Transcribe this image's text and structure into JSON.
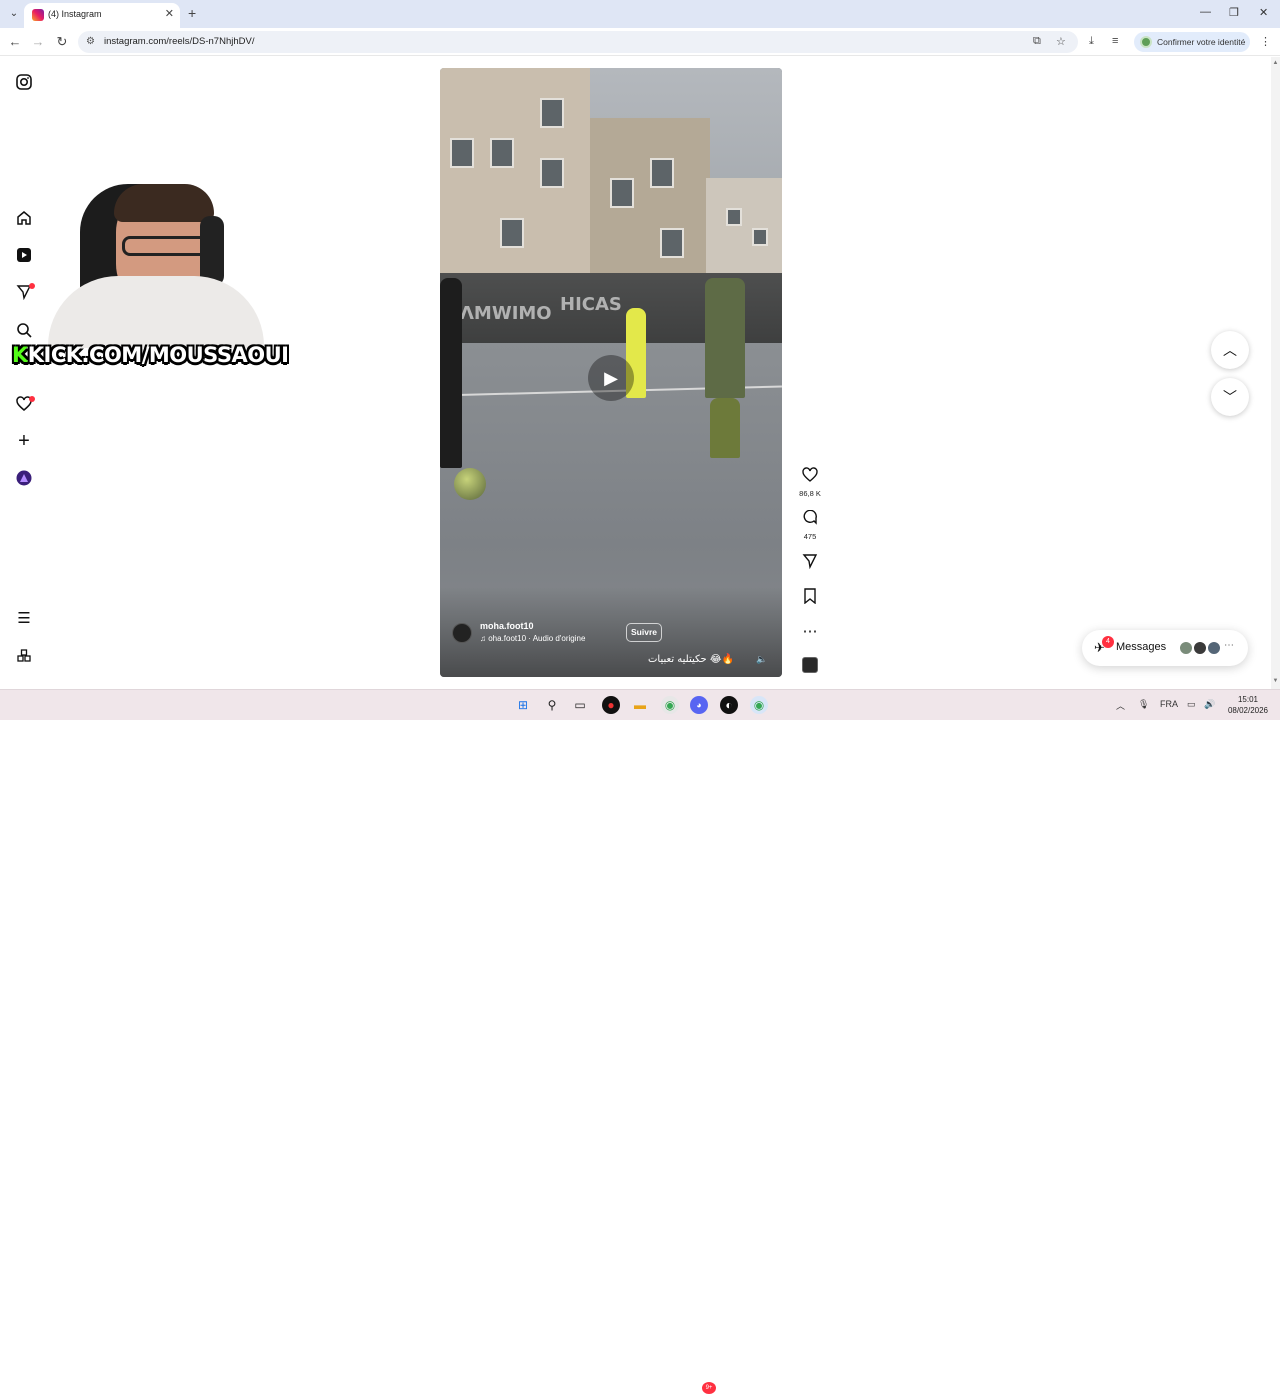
{
  "browser": {
    "tab_title": "(4) Instagram",
    "url": "instagram.com/reels/DS-n7NhjhDV/",
    "identity_label": "Confirmer votre identité"
  },
  "overlay": {
    "kick_letter": "K",
    "kick_text": "KICK.COM/MOUSSAOUI"
  },
  "sidebar": {
    "messages_badge": "4"
  },
  "reel": {
    "author": "moha.foot10",
    "audio": "oha.foot10 · Audio d'origine",
    "follow_label": "Suivre",
    "caption": "حكيتليه تعبيات 😂🔥"
  },
  "actions": {
    "likes": "86,8 K",
    "comments": "475"
  },
  "messages": {
    "label": "Messages",
    "badge": "4"
  },
  "taskbar": {
    "lang": "FRA",
    "time": "15:01",
    "date": "08/02/2026",
    "discord_badge": "9+"
  },
  "colors": {
    "kick_green": "#53fc18",
    "notification_red": "#ff3040",
    "tab_bar": "#dfe6f5"
  }
}
